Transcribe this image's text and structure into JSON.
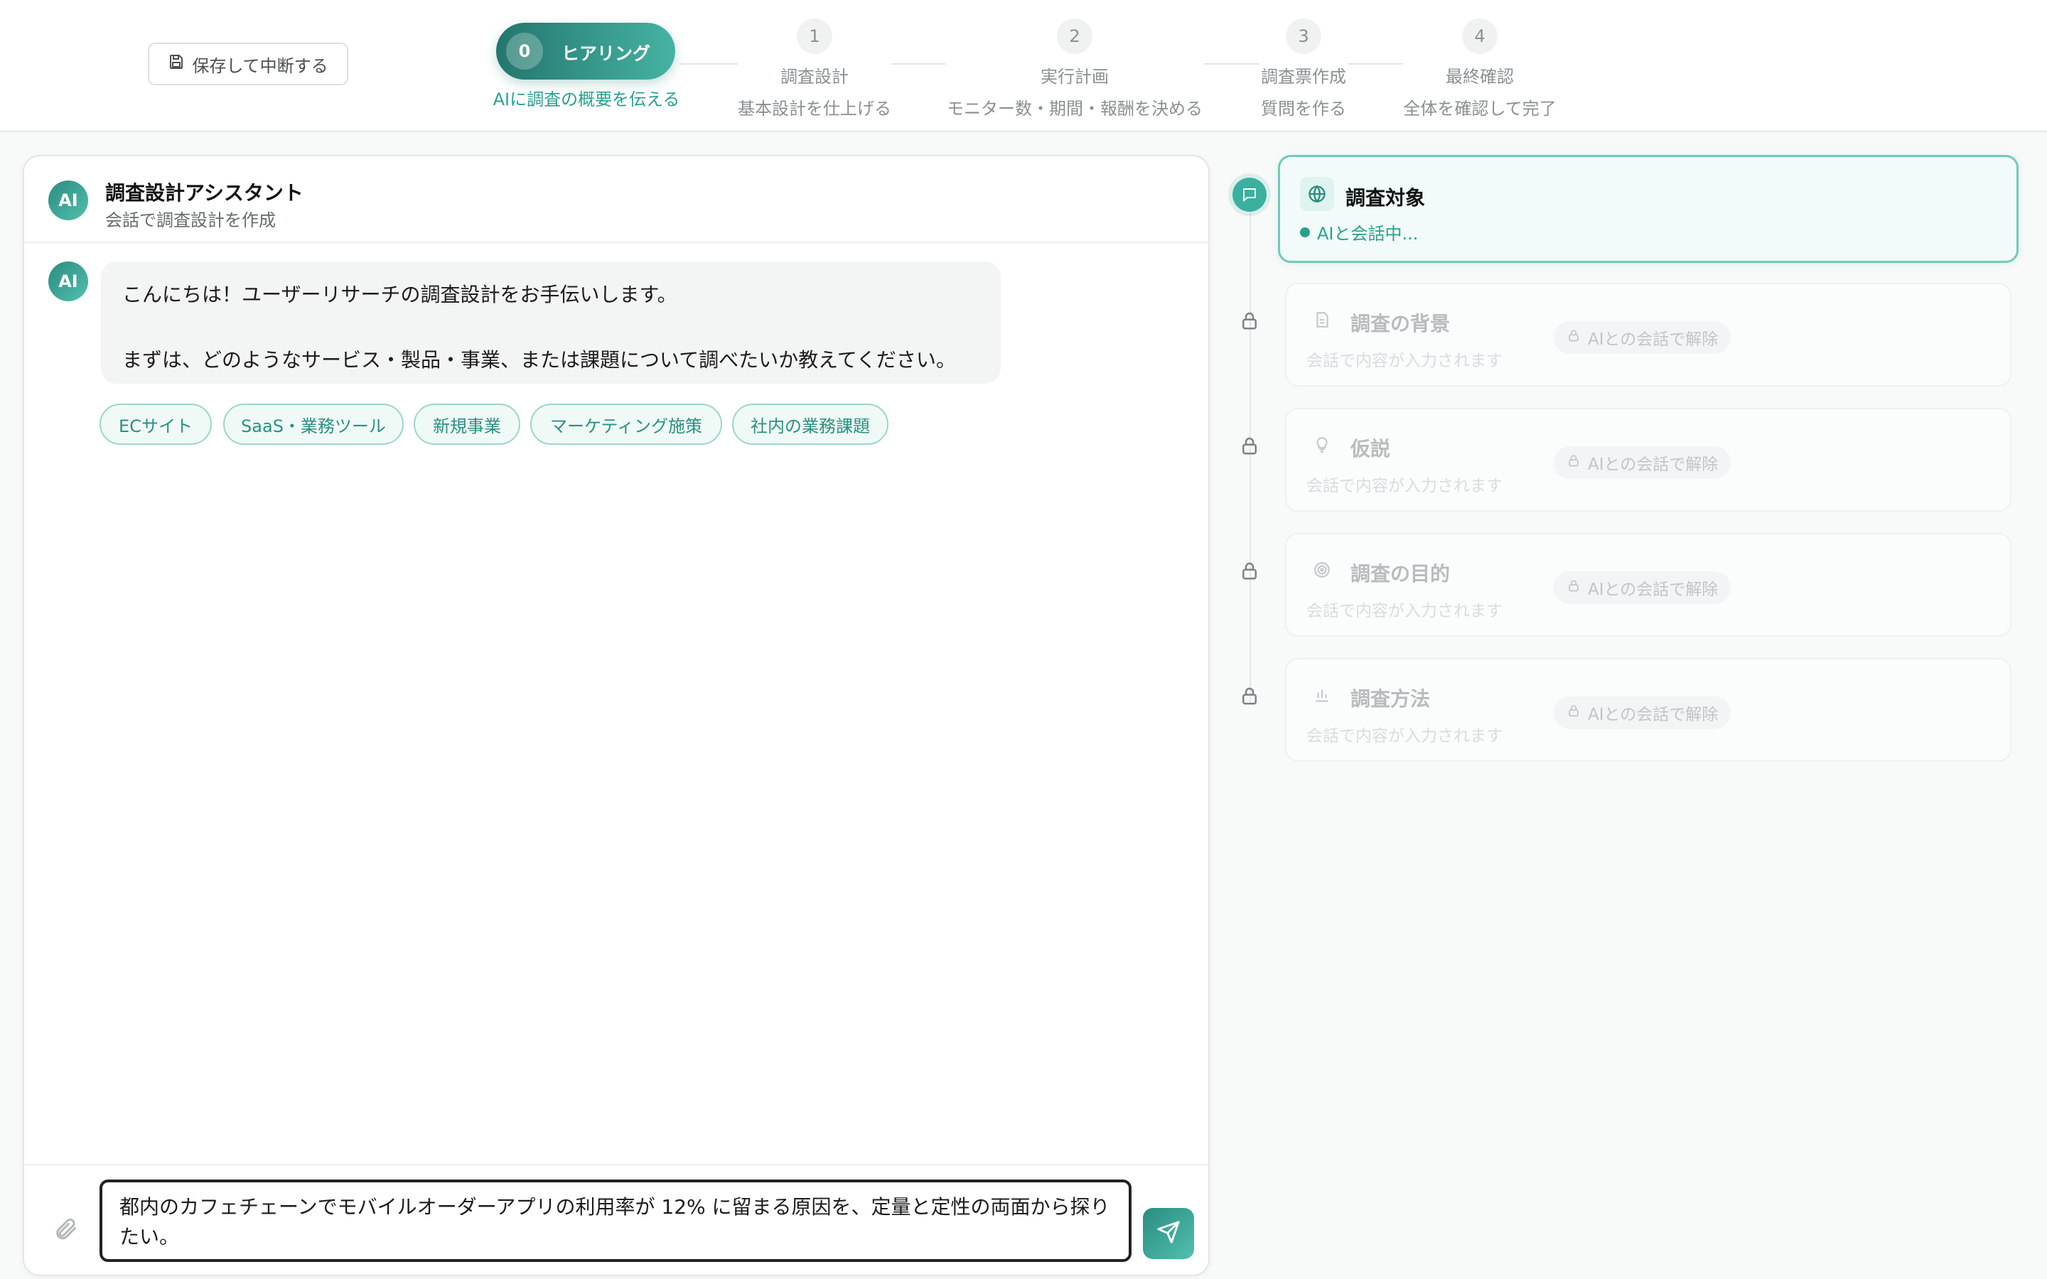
{
  "header": {
    "save_button": "保存して中断する",
    "active_step": {
      "number": "0",
      "label": "ヒアリング",
      "subtitle": "AIに調査の概要を伝える"
    },
    "steps": [
      {
        "number": "1",
        "title": "調査設計",
        "subtitle": "基本設計を仕上げる"
      },
      {
        "number": "2",
        "title": "実行計画",
        "subtitle": "モニター数・期間・報酬を決める"
      },
      {
        "number": "3",
        "title": "調査票作成",
        "subtitle": "質問を作る"
      },
      {
        "number": "4",
        "title": "最終確認",
        "subtitle": "全体を確認して完了"
      }
    ]
  },
  "chat": {
    "avatar_label": "AI",
    "title": "調査設計アシスタント",
    "subtitle": "会話で調査設計を作成",
    "message": {
      "line1": "こんにちは！ユーザーリサーチの調査設計をお手伝いします。",
      "line2": "まずは、どのようなサービス・製品・事業、または課題について調べたいか教えてください。"
    },
    "chips": [
      "ECサイト",
      "SaaS・業務ツール",
      "新規事業",
      "マーケティング施策",
      "社内の業務課題"
    ],
    "input_value": "都内のカフェチェーンでモバイルオーダーアプリの利用率が 12% に留まる原因を、定量と定性の両面から探りたい。"
  },
  "sections": {
    "active": {
      "title": "調査対象",
      "status": "AIと会話中..."
    },
    "locked": [
      {
        "title": "調査の背景",
        "placeholder": "会話で内容が入力されます",
        "badge": "AIとの会話で解除",
        "icon": "document-icon"
      },
      {
        "title": "仮説",
        "placeholder": "会話で内容が入力されます",
        "badge": "AIとの会話で解除",
        "icon": "lightbulb-icon"
      },
      {
        "title": "調査の目的",
        "placeholder": "会話で内容が入力されます",
        "badge": "AIとの会話で解除",
        "icon": "target-icon"
      },
      {
        "title": "調査方法",
        "placeholder": "会話で内容が入力されます",
        "badge": "AIとの会話で解除",
        "icon": "bar-chart-icon"
      }
    ]
  },
  "colors": {
    "accent": "#3bb09e",
    "accent_dark": "#24766d",
    "chip_border": "#9bd6cb"
  }
}
